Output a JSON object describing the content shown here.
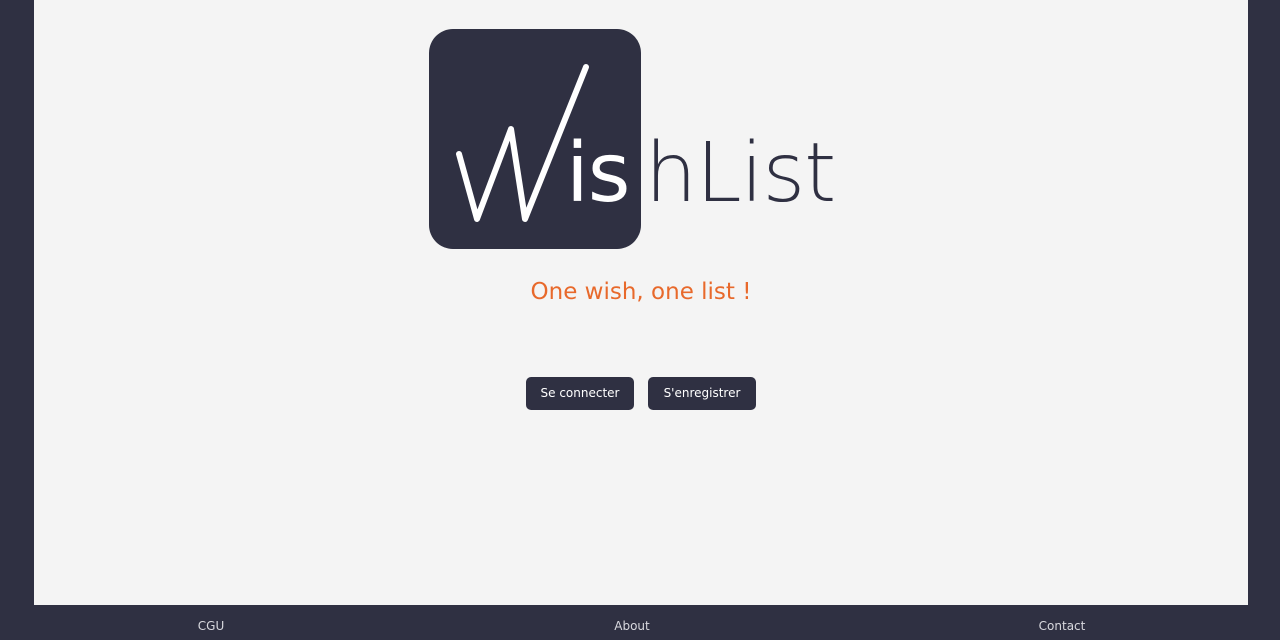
{
  "logo": {
    "initial": "W",
    "letters_on_box": "is",
    "letters_off_box": "hList",
    "full_text": "WishList"
  },
  "tagline": "One wish, one list !",
  "buttons": {
    "login": "Se connecter",
    "register": "S'enregistrer"
  },
  "footer": {
    "links": [
      "CGU",
      "About",
      "Contact"
    ]
  },
  "colors": {
    "background": "#2f3042",
    "page": "#f4f4f4",
    "accent": "#e8692b",
    "button": "#2f3042"
  }
}
